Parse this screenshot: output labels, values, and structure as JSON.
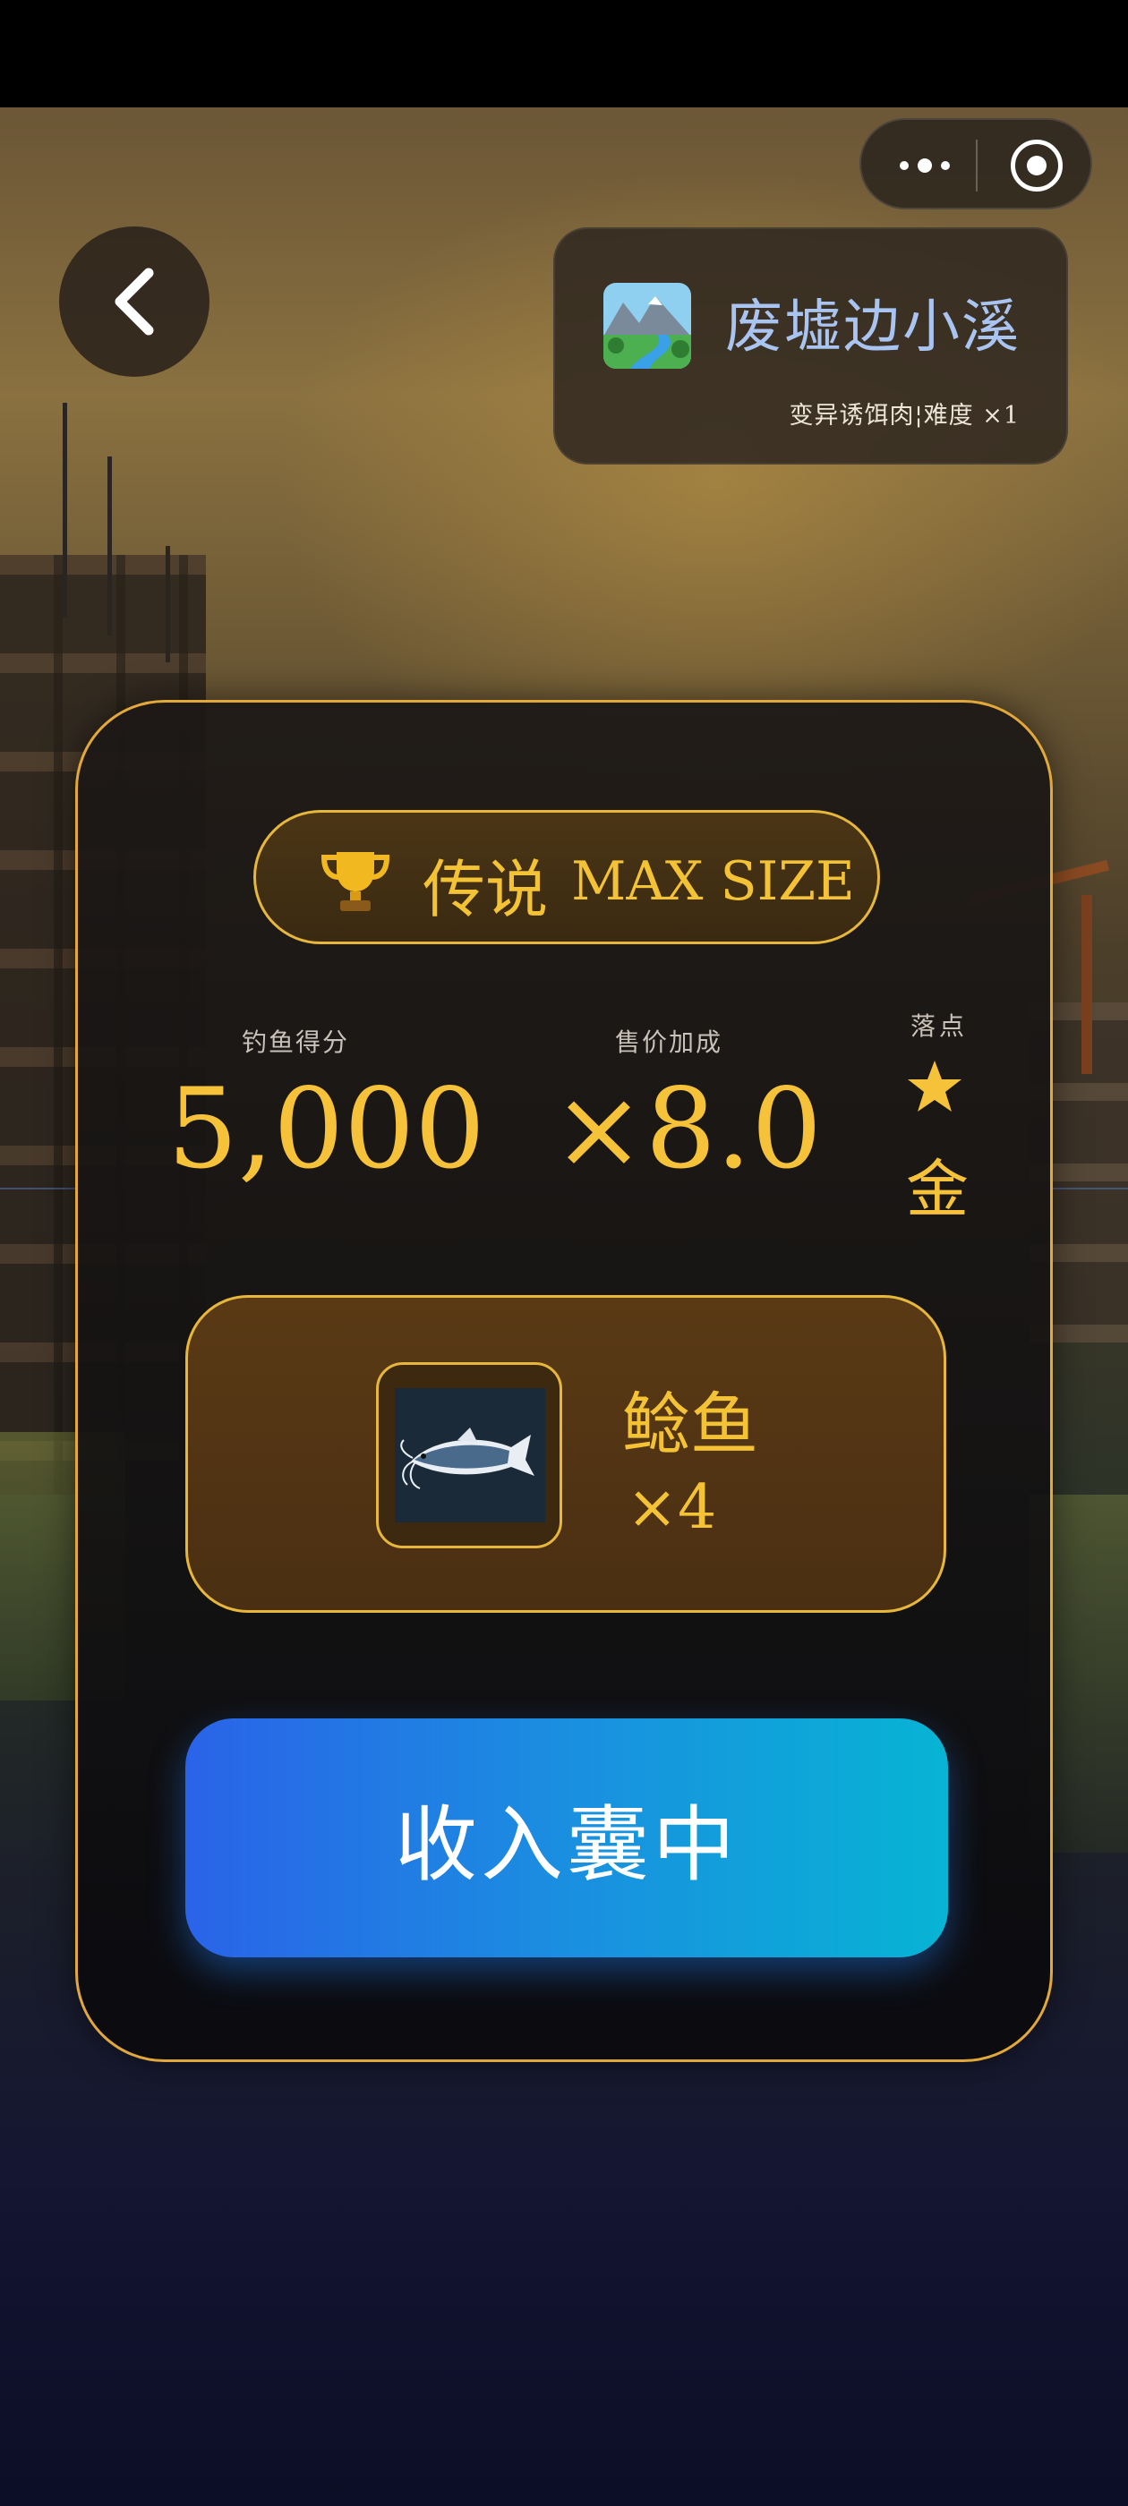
{
  "location": {
    "title": "废墟边小溪",
    "subtitle": "变异诱饵肉¦难度 ×1",
    "icon": "river-landscape-icon"
  },
  "result": {
    "rank": "传说",
    "size": "MAX SIZE",
    "score_label": "钓鱼得分",
    "score_value": "5,000",
    "bonus_label": "售价加成",
    "bonus_value": "×8.0",
    "landing_label": "落点",
    "landing_value": "金",
    "landing_icon": "star-icon"
  },
  "catch": {
    "name": "鲶鱼",
    "count": "×4",
    "icon": "catfish-icon"
  },
  "actions": {
    "collect_label": "收入囊中"
  },
  "colors": {
    "accent_gold": "#f6c23a",
    "button_gradient_start": "#2a63e8",
    "button_gradient_end": "#07b4d4",
    "location_title": "#a9c4f0"
  }
}
